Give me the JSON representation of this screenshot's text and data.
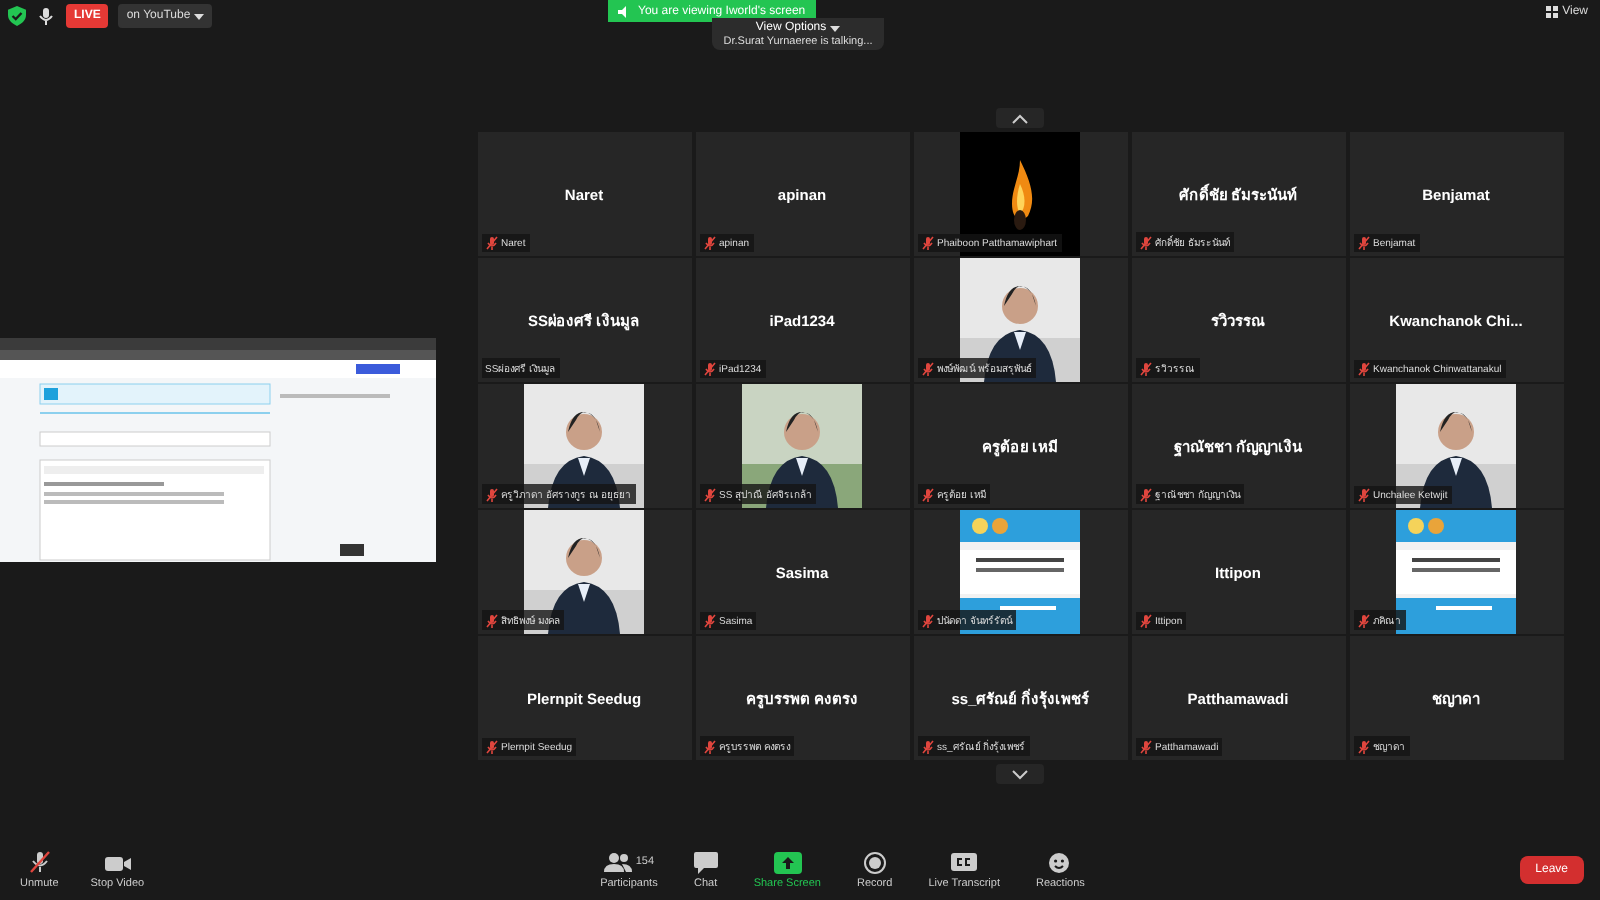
{
  "top_bar": {
    "live_badge": "LIVE",
    "stream_menu": "on YouTube",
    "sharing_banner": "You are viewing Iworld's screen",
    "view_options": "View Options",
    "talking": "Dr.Surat  Yurnaeree is talking...",
    "view_button": "View"
  },
  "gallery": {
    "tiles": [
      {
        "kind": "name",
        "display": "Naret",
        "label": "Naret",
        "muted": true
      },
      {
        "kind": "name",
        "display": "apinan",
        "label": "apinan",
        "muted": true
      },
      {
        "kind": "picture",
        "label": "Phaiboon Patthamawiphart",
        "muted": true
      },
      {
        "kind": "name",
        "display": "ศักดิ์ชัย ธัมระนันท์",
        "label": "ศักดิ์ชัย ธัมระนันท์",
        "muted": true
      },
      {
        "kind": "name",
        "display": "Benjamat",
        "label": "Benjamat",
        "muted": true
      },
      {
        "kind": "name",
        "display": "SSผ่องศรี เงินมูล",
        "label": "SSผ่องศรี เงินมูล",
        "muted": false
      },
      {
        "kind": "name",
        "display": "iPad1234",
        "label": "iPad1234",
        "muted": true
      },
      {
        "kind": "picture",
        "label": "พงษ์พัฒน์ พร้อมสรุพันธ์",
        "muted": true
      },
      {
        "kind": "name",
        "display": "รวิวรรณ",
        "label": "รวิวรรณ",
        "muted": true
      },
      {
        "kind": "name",
        "display": "Kwanchanok  Chi...",
        "label": "Kwanchanok Chinwattanakul",
        "muted": true
      },
      {
        "kind": "picture",
        "label": "ครูวิภาดา อัศรางกูร ณ อยุธยา",
        "muted": true
      },
      {
        "kind": "picture",
        "label": "SS สุปาณี อัศจิรเกล้า",
        "muted": true
      },
      {
        "kind": "name",
        "display": "ครูต้อย เหมี",
        "label": "ครูต้อย เหมี",
        "muted": true
      },
      {
        "kind": "name",
        "display": "ฐาณัชชา กัญญาเงิน",
        "label": "ฐาณัชชา กัญญาเงิน",
        "muted": true
      },
      {
        "kind": "picture",
        "label": "Unchalee Ketwjit",
        "muted": true
      },
      {
        "kind": "picture",
        "label": "สิทธิพงษ์ มงคล",
        "muted": true
      },
      {
        "kind": "name",
        "display": "Sasima",
        "label": "Sasima",
        "muted": true
      },
      {
        "kind": "picture",
        "label": "ปนัดดา จันทร์รัตน์",
        "muted": true
      },
      {
        "kind": "name",
        "display": "Ittipon",
        "label": "Ittipon",
        "muted": true
      },
      {
        "kind": "picture",
        "label": "ภคิณา",
        "muted": true
      },
      {
        "kind": "name",
        "display": "Plernpit Seedug",
        "label": "Plernpit Seedug",
        "muted": true
      },
      {
        "kind": "name",
        "display": "ครูบรรพต คงตรง",
        "label": "ครูบรรพต คงตรง",
        "muted": true
      },
      {
        "kind": "name",
        "display": "ss_ศรัณย์ กิ่งรุ้งเพชร์",
        "label": "ss_ศรัณย์ กิ่งรุ้งเพชร์",
        "muted": true
      },
      {
        "kind": "name",
        "display": "Patthamawadi",
        "label": "Patthamawadi",
        "muted": true
      },
      {
        "kind": "name",
        "display": "ชญาดา",
        "label": "ชญาดา",
        "muted": true
      }
    ]
  },
  "toolbar": {
    "left": [
      {
        "kind": "mic",
        "label": "Unmute"
      },
      {
        "kind": "video",
        "label": "Stop Video"
      }
    ],
    "center": [
      {
        "kind": "participants",
        "label": "Participants",
        "count": "154"
      },
      {
        "kind": "chat",
        "label": "Chat"
      },
      {
        "kind": "share",
        "label": "Share Screen"
      },
      {
        "kind": "record",
        "label": "Record"
      },
      {
        "kind": "cc",
        "label": "Live Transcript"
      },
      {
        "kind": "reactions",
        "label": "Reactions"
      }
    ],
    "leave": "Leave"
  }
}
